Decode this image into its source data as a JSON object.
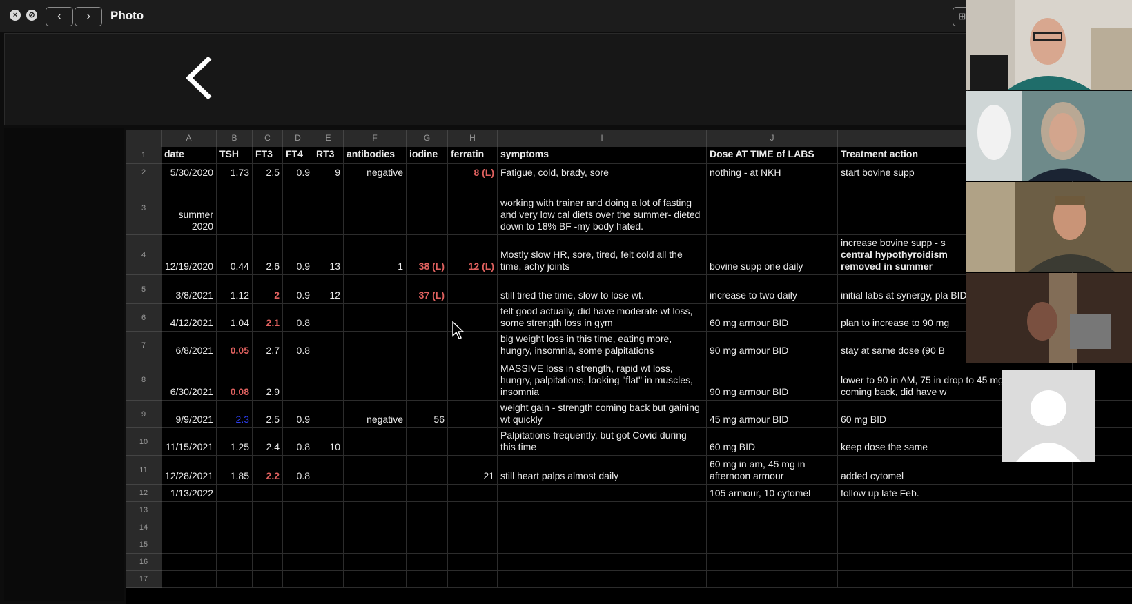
{
  "window": {
    "title": "Photo",
    "back_arrow": "‹",
    "forward_arrow": "›",
    "close_glyph": "×",
    "minimize_glyph": "⊘",
    "grid_glyph": "⊞"
  },
  "toolbar": {
    "back_glyph": "<"
  },
  "sheet": {
    "columns": [
      "A",
      "B",
      "C",
      "D",
      "E",
      "F",
      "G",
      "H",
      "I",
      "J"
    ],
    "row_numbers": [
      "1",
      "2",
      "3",
      "4",
      "5",
      "6",
      "7",
      "8",
      "9",
      "10",
      "11",
      "12",
      "13",
      "14",
      "15",
      "16",
      "17"
    ],
    "headers": [
      "date",
      "TSH",
      "FT3",
      "FT4",
      "RT3",
      "antibodies",
      "iodine",
      "ferratin",
      "symptoms",
      "Dose AT TIME of LABS",
      "Treatment action"
    ],
    "rows": [
      {
        "date": "5/30/2020",
        "tsh": "1.73",
        "ft3": "2.5",
        "ft4": "0.9",
        "rt3": "9",
        "antibodies": "negative",
        "iodine": "",
        "ferratin": "8 (L)",
        "symptoms": "Fatigue, cold, brady, sore",
        "dose": "nothing - at NKH",
        "treatment": "start bovine supp"
      },
      {
        "date": "summer 2020",
        "tsh": "",
        "ft3": "",
        "ft4": "",
        "rt3": "",
        "antibodies": "",
        "iodine": "",
        "ferratin": "",
        "symptoms": "working with trainer and doing a lot of fasting and very low cal diets over the summer- dieted down to 18% BF -my body hated.",
        "dose": "",
        "treatment": ""
      },
      {
        "date": "12/19/2020",
        "tsh": "0.44",
        "ft3": "2.6",
        "ft4": "0.9",
        "rt3": "13",
        "antibodies": "1",
        "iodine": "38 (L)",
        "ferratin": "12 (L)",
        "symptoms": "Mostly slow HR, sore, tired, felt cold all the time, achy joints",
        "dose": "bovine supp one daily",
        "treatment": "increase bovine supp - s",
        "treatment_b1": "central hypothyroidism",
        "treatment_b2": "removed in summer"
      },
      {
        "date": "3/8/2021",
        "tsh": "1.12",
        "ft3": "2",
        "ft4": "0.9",
        "rt3": "12",
        "antibodies": "",
        "iodine": "37 (L)",
        "ferratin": "",
        "symptoms": "still tired the time, slow to lose wt.",
        "dose": "increase to two daily",
        "treatment": "initial labs at synergy, pla BID"
      },
      {
        "date": "4/12/2021",
        "tsh": "1.04",
        "ft3": "2.1",
        "ft4": "0.8",
        "rt3": "",
        "antibodies": "",
        "iodine": "",
        "ferratin": "",
        "symptoms": "felt good actually, did have moderate wt loss, some strength loss in gym",
        "dose": "60 mg armour BID",
        "treatment": "plan to increase to 90 mg"
      },
      {
        "date": "6/8/2021",
        "tsh": "0.05",
        "ft3": "2.7",
        "ft4": "0.8",
        "rt3": "",
        "antibodies": "",
        "iodine": "",
        "ferratin": "",
        "symptoms": "big weight loss in this time, eating more, hungry, insomnia, some palpitations",
        "dose": "90 mg armour BID",
        "treatment": "stay at same dose  (90 B"
      },
      {
        "date": "6/30/2021",
        "tsh": "0.08",
        "ft3": "2.9",
        "ft4": "",
        "rt3": "",
        "antibodies": "",
        "iodine": "",
        "ferratin": "",
        "symptoms": "MASSIVE loss in strength, rapid wt loss, hungry, palpitations, looking \"flat\" in muscles, insomnia",
        "dose": "90 mg armour BID",
        "treatment": "lower to 90 in AM, 75 in drop to 45 mg twice a da coming back, did have w"
      },
      {
        "date": "9/9/2021",
        "tsh": "2.3",
        "ft3": "2.5",
        "ft4": "0.9",
        "rt3": "",
        "antibodies": "negative",
        "iodine": "56",
        "ferratin": "",
        "symptoms": "weight gain - strength coming back but gaining wt quickly",
        "dose": "45 mg armour BID",
        "treatment": " 60 mg BID"
      },
      {
        "date": "11/15/2021",
        "tsh": "1.25",
        "ft3": "2.4",
        "ft4": "0.8",
        "rt3": "10",
        "antibodies": "",
        "iodine": "",
        "ferratin": "",
        "symptoms": "Palpitations frequently, but got Covid during this time",
        "dose": "60 mg BID",
        "treatment": "keep dose the same"
      },
      {
        "date": "12/28/2021",
        "tsh": "1.85",
        "ft3": "2.2",
        "ft4": "0.8",
        "rt3": "",
        "antibodies": "",
        "iodine": "",
        "ferratin": "21",
        "symptoms": "still heart palps almost daily",
        "dose": "60 mg in am, 45 mg in afternoon armour",
        "treatment": "added cytomel"
      },
      {
        "date": "1/13/2022",
        "tsh": "",
        "ft3": "",
        "ft4": "",
        "rt3": "",
        "antibodies": "",
        "iodine": "",
        "ferratin": "",
        "symptoms": "",
        "dose": "105 armour,  10 cytomel",
        "treatment": "follow up late Feb."
      }
    ]
  },
  "colors": {
    "low_value": "#e0615f",
    "blue_value": "#2e3ff0",
    "background": "#000000"
  },
  "icons": {
    "cursor": "mouse-pointer-icon",
    "avatar": "user-placeholder-icon"
  }
}
